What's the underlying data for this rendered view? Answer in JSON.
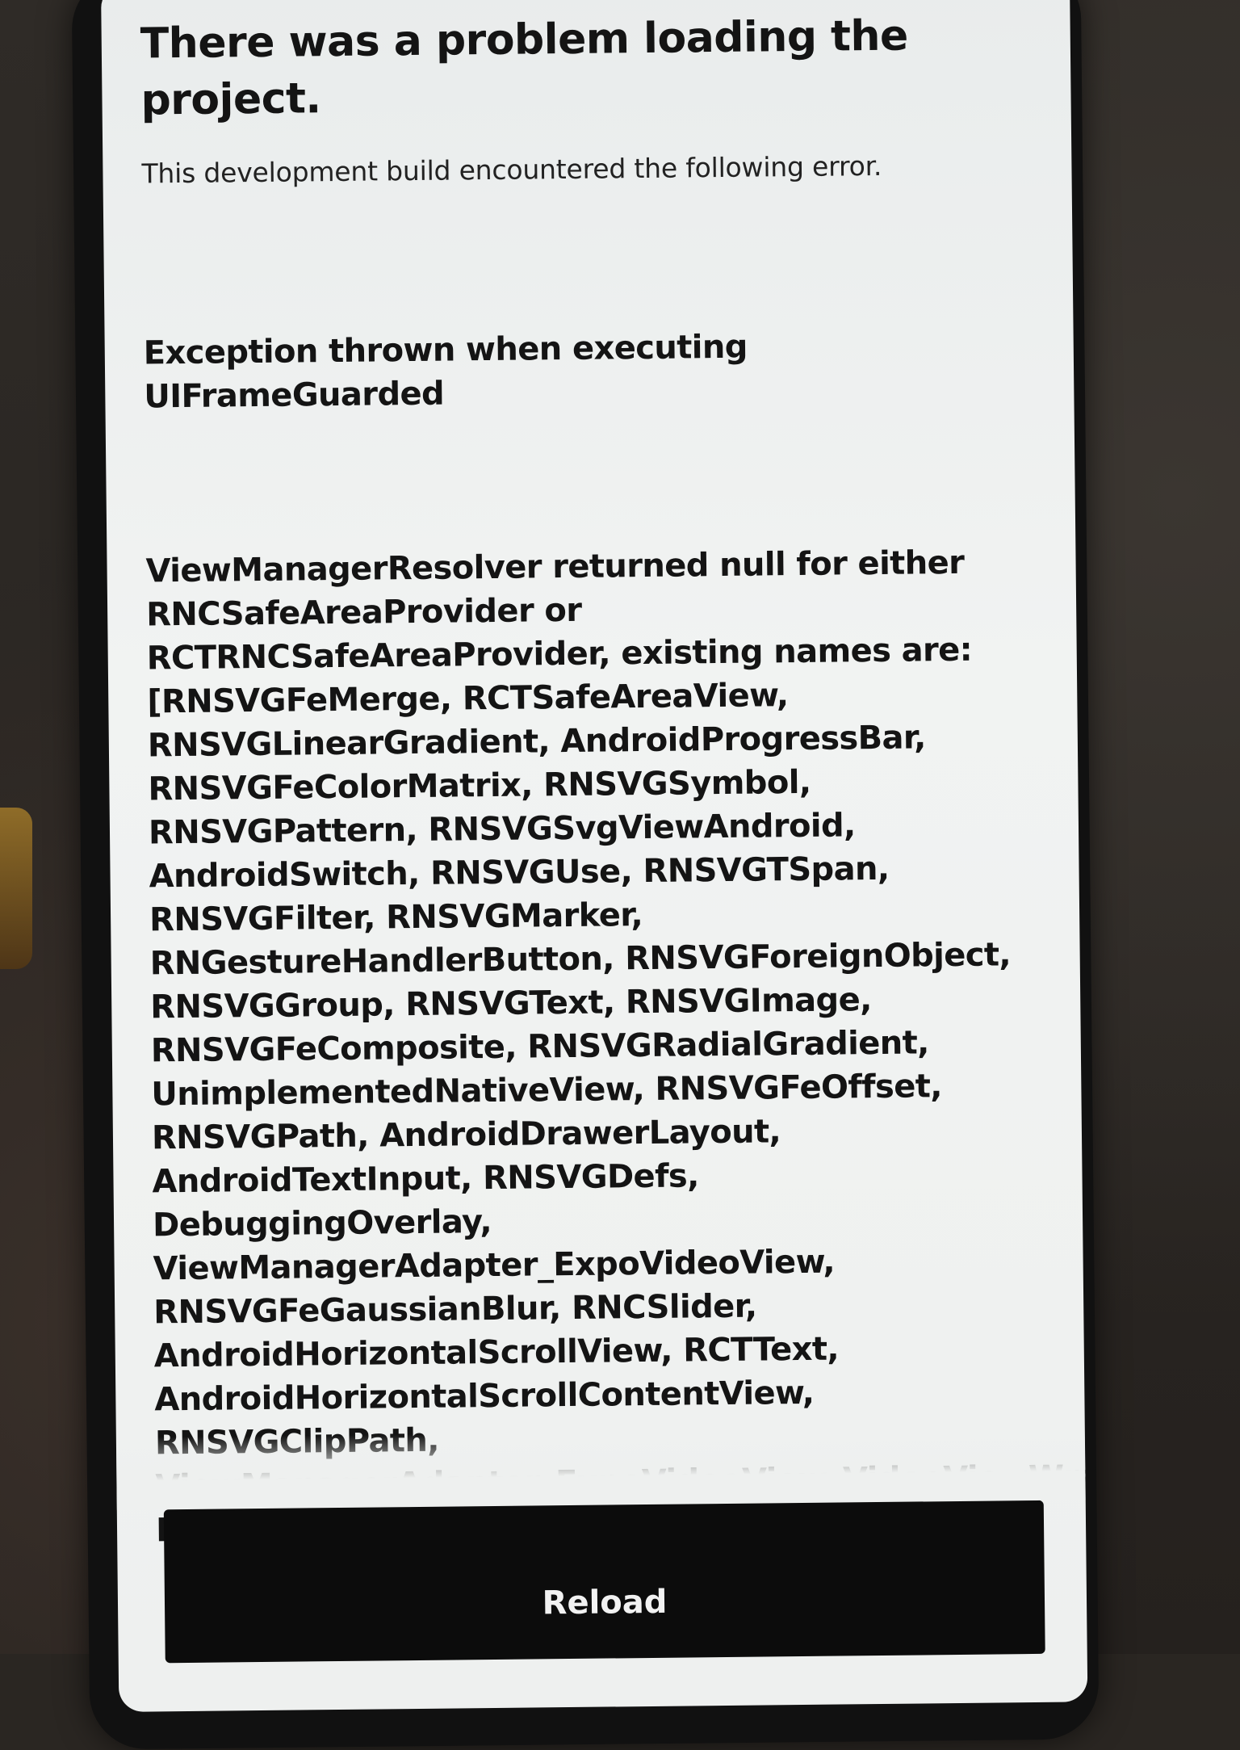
{
  "error_screen": {
    "title": "There was a problem loading the project.",
    "subtitle": "This development build encountered the following error.",
    "error_heading": "Exception thrown when executing UIFrameGuarded",
    "error_message": "ViewManagerResolver returned null for either RNCSafeAreaProvider or RCTRNCSafeAreaProvider, existing names are: [RNSVGFeMerge, RCTSafeAreaView, RNSVGLinearGradient, AndroidProgressBar, RNSVGFeColorMatrix, RNSVGSymbol, RNSVGPattern, RNSVGSvgViewAndroid, AndroidSwitch, RNSVGUse, RNSVGTSpan, RNSVGFilter, RNSVGMarker, RNGestureHandlerButton, RNSVGForeignObject, RNSVGGroup, RNSVGText, RNSVGImage, RNSVGFeComposite, RNSVGRadialGradient, UnimplementedNativeView, RNSVGFeOffset, RNSVGPath, AndroidDrawerLayout, AndroidTextInput, RNSVGDefs, DebuggingOverlay, ViewManagerAdapter_ExpoVideoView, RNSVGFeGaussianBlur, RNCSlider, AndroidHorizontalScrollView, RCTText, AndroidHorizontalScrollContentView, RNSVGClipPath, ViewManagerAdapter_ExpoVideoView_VideoViewWrapper, RNSVGFeBlend, RCTView, RNSVGCircle,",
    "reload_label": "Reload"
  },
  "colors": {
    "screen_background": "#eef0ef",
    "text": "#141414",
    "button_background": "#0c0c0c",
    "button_text": "#f2f2f2"
  }
}
